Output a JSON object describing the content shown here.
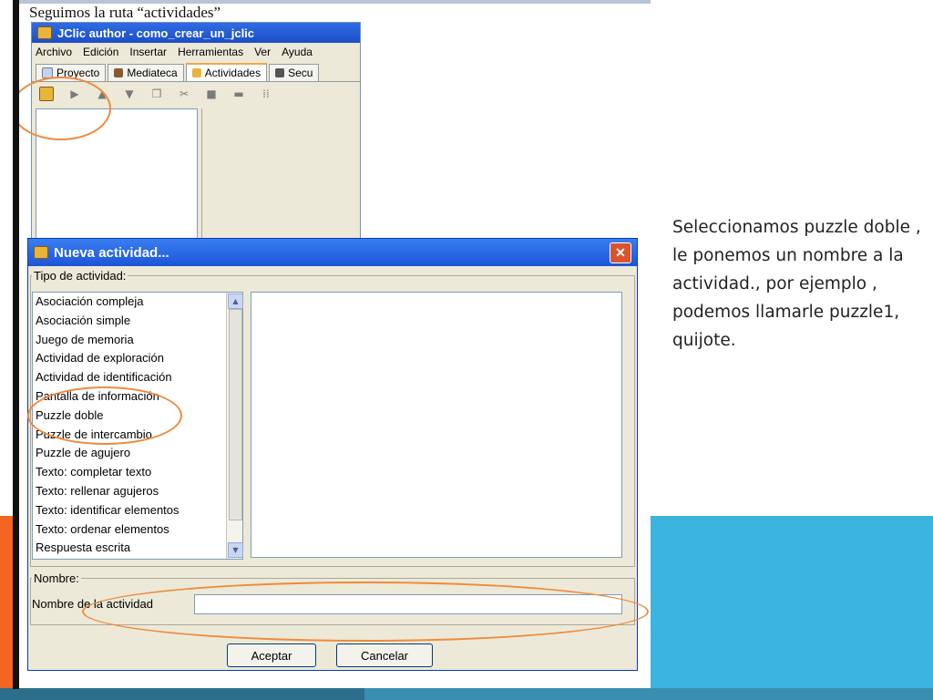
{
  "slide": {
    "heading": "Seguimos la ruta “actividades”",
    "caption": "Seleccionamos puzzle doble , le ponemos un nombre a la actividad., por ejemplo , podemos llamarle puzzle1, quijote."
  },
  "jclic_window": {
    "title": "JClic author - como_crear_un_jclic",
    "menu": [
      "Archivo",
      "Edición",
      "Insertar",
      "Herramientas",
      "Ver",
      "Ayuda"
    ],
    "tabs": [
      "Proyecto",
      "Mediateca",
      "Actividades",
      "Secu"
    ],
    "active_tab": "Actividades"
  },
  "dialog": {
    "title": "Nueva actividad...",
    "type_group_label": "Tipo de actividad:",
    "activity_types": [
      "Asociación compleja",
      "Asociación simple",
      "Juego de memoria",
      "Actividad de exploración",
      "Actividad de identificación",
      "Pantalla de información",
      "Puzzle doble",
      "Puzzle de intercambio",
      "Puzzle de agujero",
      "Texto: completar texto",
      "Texto: rellenar agujeros",
      "Texto: identificar elementos",
      "Texto: ordenar elementos",
      "Respuesta escrita"
    ],
    "name_group_label": "Nombre:",
    "name_field_label": "Nombre de la actividad",
    "name_field_value": "",
    "ok_label": "Aceptar",
    "cancel_label": "Cancelar"
  },
  "colors": {
    "annotation_ring": "#f08a3c",
    "slide_orange": "#f26522",
    "slide_blue": "#3cb4e0",
    "titlebar_blue": "#1c55d8"
  }
}
